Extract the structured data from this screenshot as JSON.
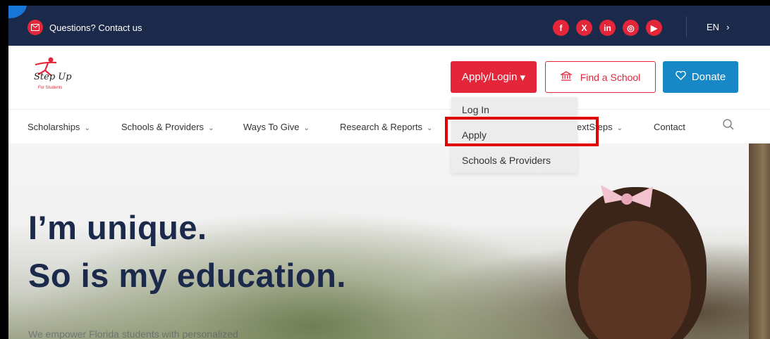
{
  "topbar": {
    "contact_label": "Questions? Contact us",
    "socials": [
      {
        "name": "facebook-icon",
        "glyph": "f"
      },
      {
        "name": "x-icon",
        "glyph": "X"
      },
      {
        "name": "linkedin-icon",
        "glyph": "in"
      },
      {
        "name": "instagram-icon",
        "glyph": "◎"
      },
      {
        "name": "youtube-icon",
        "glyph": "▶"
      }
    ],
    "language": "EN",
    "language_chevron": "›"
  },
  "header": {
    "logo_text": "Step Up",
    "logo_sub": "For Students",
    "apply_login_label": "Apply/Login",
    "find_school_label": "Find a School",
    "donate_label": "Donate"
  },
  "nav": {
    "items": [
      "Scholarships",
      "Schools & Providers",
      "Ways To Give",
      "Research & Reports",
      "extSteps",
      "Contact"
    ]
  },
  "dropdown": {
    "items": [
      "Log In",
      "Apply",
      "Schools & Providers"
    ]
  },
  "hero": {
    "line1": "I’m unique.",
    "line2": "So is my education.",
    "sub": "We empower Florida students with personalized"
  },
  "colors": {
    "navy": "#1b2a4a",
    "brand_red": "#e3263a",
    "donate_blue": "#1788c5",
    "highlight_red": "#e10000"
  }
}
